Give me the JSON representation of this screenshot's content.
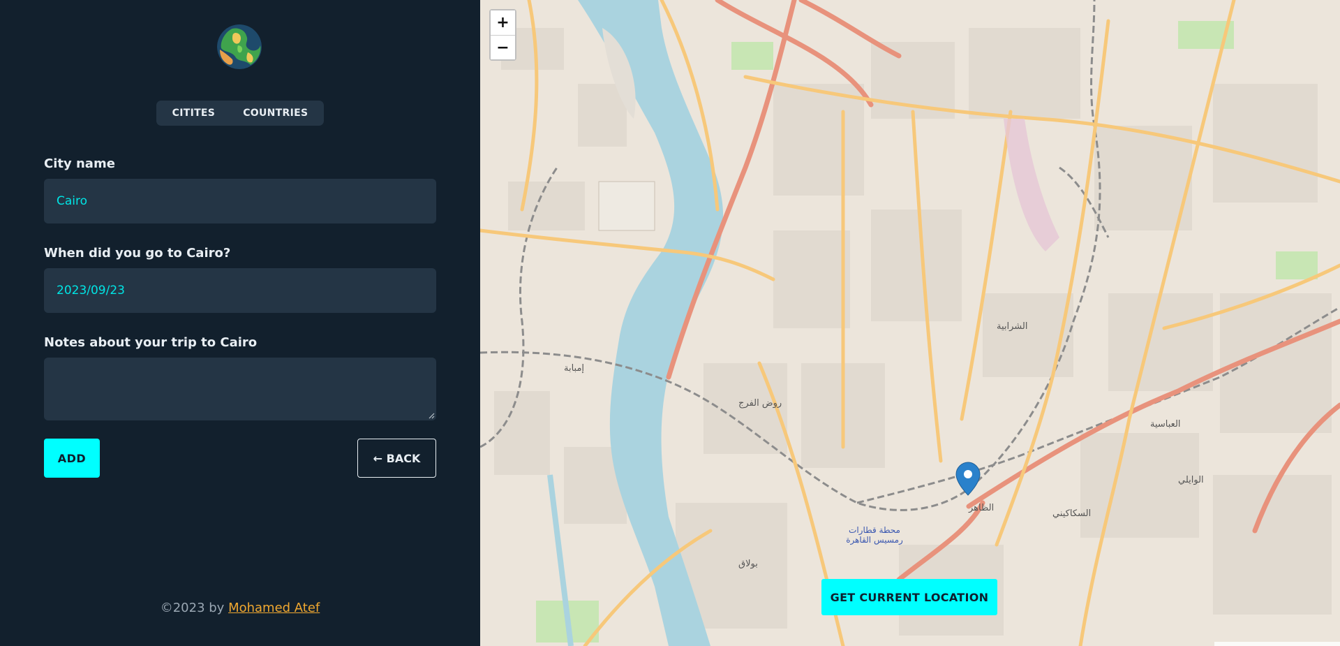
{
  "sidebar": {
    "logo_icon": "globe-icon",
    "tabs": [
      {
        "label": "CITITES"
      },
      {
        "label": "COUNTRIES"
      }
    ],
    "form": {
      "city_label": "City name",
      "city_value": "Cairo",
      "date_label": "When did you go to Cairo?",
      "date_value": "2023/09/23",
      "notes_label": "Notes about your trip to Cairo",
      "notes_value": "",
      "add_label": "ADD",
      "back_label": "← BACK"
    },
    "footer": {
      "text": "©2023 by ",
      "link": "Mohamed Atef"
    }
  },
  "map": {
    "zoom_in": "+",
    "zoom_out": "−",
    "geolocation_button": "GET CURRENT LOCATION",
    "marker_icon": "map-pin-icon",
    "labels": [
      {
        "id": "imbaba",
        "text": "إمبابة"
      },
      {
        "id": "bulaq",
        "text": "بولاق"
      },
      {
        "id": "shubra",
        "text": "الشرابية"
      },
      {
        "id": "abbasiya",
        "text": "العباسية"
      },
      {
        "id": "sakakini",
        "text": "السكاكيني"
      },
      {
        "id": "daher",
        "text": "الظاهر"
      },
      {
        "id": "zamalek",
        "text": "روض الفرج"
      },
      {
        "id": "waily",
        "text": "الوايلي"
      },
      {
        "id": "ramses",
        "text": "محطة قطارات رمسيس القاهرة"
      }
    ],
    "colors": {
      "water": "#aad3df",
      "major_road": "#e8927c",
      "secondary_road": "#f7c87a",
      "railway": "#888888",
      "marker": "#2a81cb"
    }
  }
}
